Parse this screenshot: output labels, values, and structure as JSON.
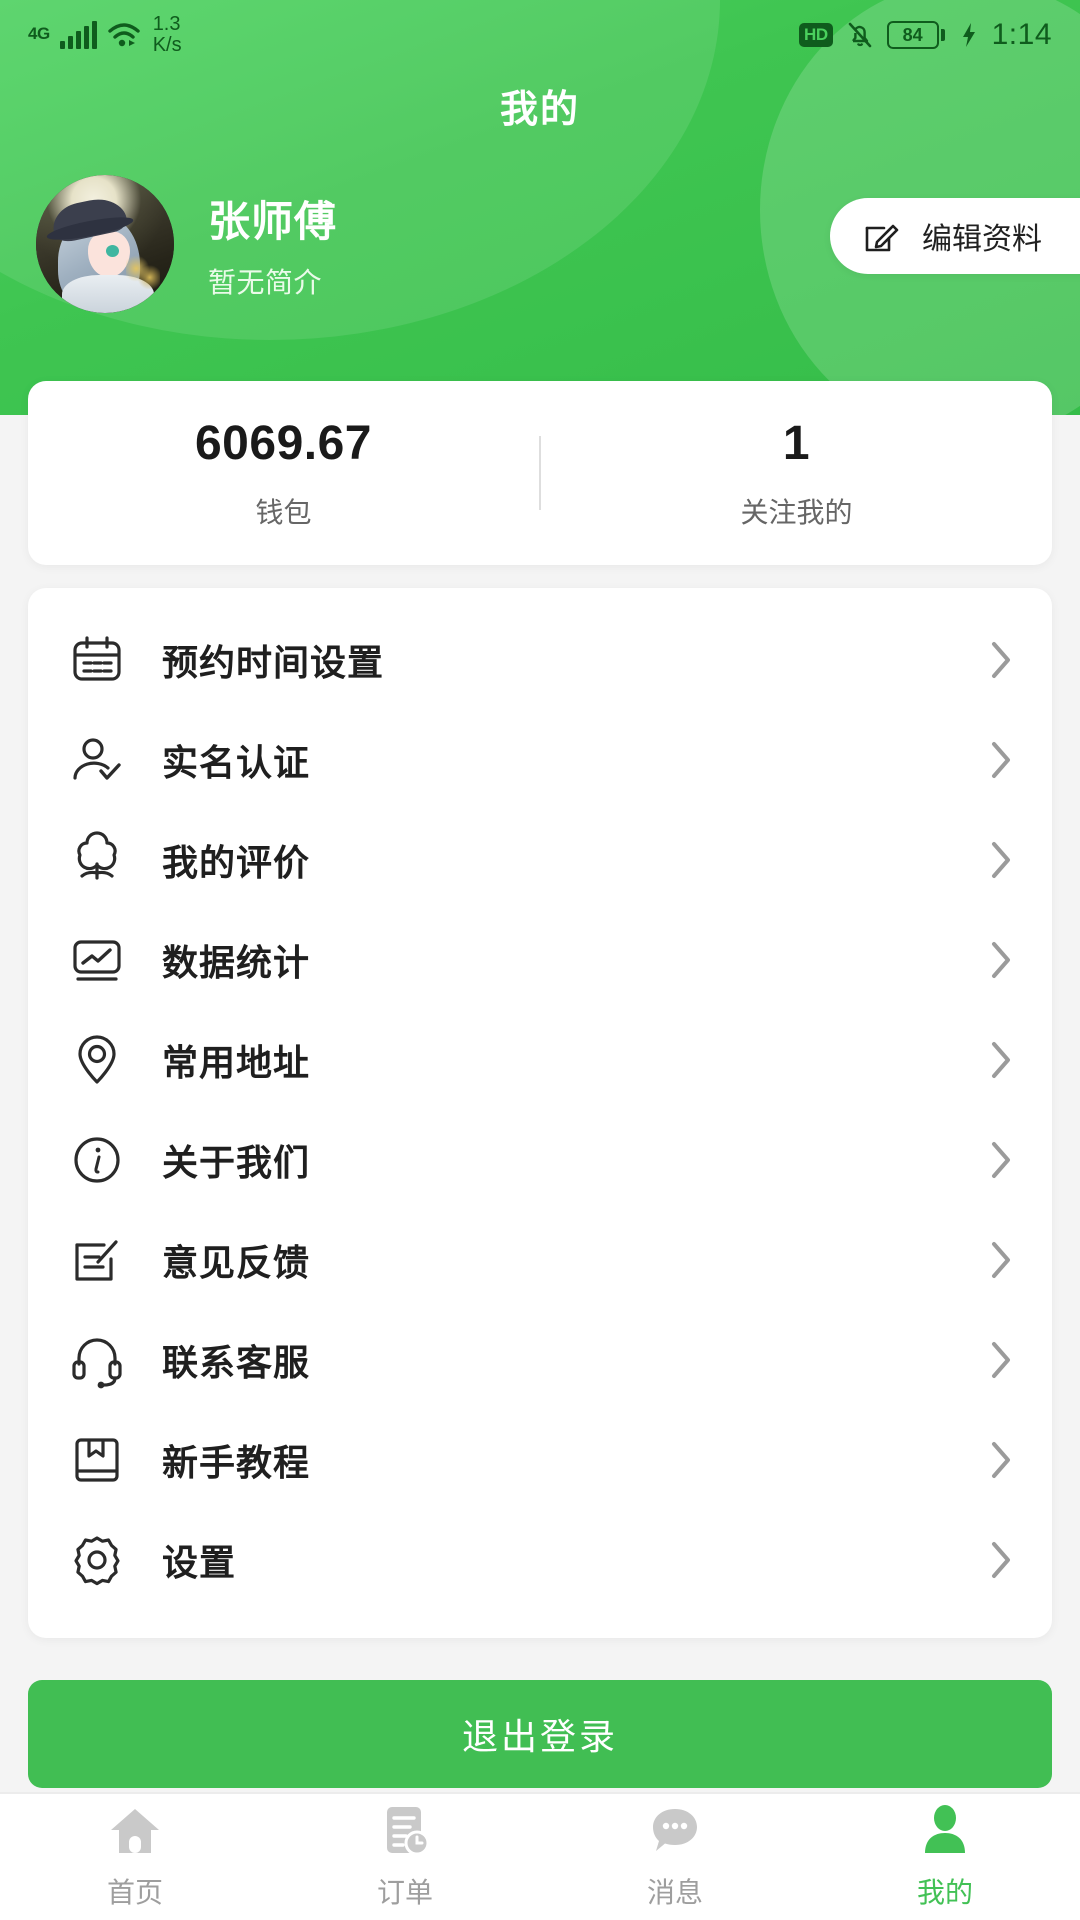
{
  "theme": {
    "brand_green": "#41be53",
    "header_gradient_from": "#4cd15f",
    "header_gradient_to": "#35bd49",
    "page_bg": "#f4f4f4",
    "card_bg": "#ffffff",
    "active_tab_color": "#42c155",
    "inactive_tab_color": "#9e9e9e"
  },
  "status_bar": {
    "network_generation": "4G",
    "net_speed": "1.3",
    "net_speed_unit": "K/s",
    "hd_badge": "HD",
    "battery_percent": "84",
    "time": "1:14",
    "icons": [
      "signal-bars-icon",
      "wifi-icon",
      "hd-icon",
      "bell-muted-icon",
      "battery-icon",
      "charging-bolt-icon"
    ]
  },
  "header": {
    "title": "我的"
  },
  "profile": {
    "name": "张师傅",
    "bio": "暂无简介",
    "avatar_alt": "avatar",
    "edit_button_label": "编辑资料"
  },
  "stats": [
    {
      "value": "6069.67",
      "label": "钱包"
    },
    {
      "value": "1",
      "label": "关注我的"
    }
  ],
  "menu": {
    "items": [
      {
        "label": "预约时间设置",
        "icon": "calendar-icon"
      },
      {
        "label": "实名认证",
        "icon": "user-verified-icon"
      },
      {
        "label": "我的评价",
        "icon": "flower-rating-icon"
      },
      {
        "label": "数据统计",
        "icon": "chart-statistics-icon"
      },
      {
        "label": "常用地址",
        "icon": "location-pin-icon"
      },
      {
        "label": "关于我们",
        "icon": "info-circle-icon"
      },
      {
        "label": "意见反馈",
        "icon": "feedback-edit-icon"
      },
      {
        "label": "联系客服",
        "icon": "headset-icon"
      },
      {
        "label": "新手教程",
        "icon": "book-icon"
      },
      {
        "label": "设置",
        "icon": "gear-icon"
      }
    ]
  },
  "logout": {
    "label": "退出登录"
  },
  "tabbar": {
    "items": [
      {
        "label": "首页",
        "icon": "home-icon",
        "active": false
      },
      {
        "label": "订单",
        "icon": "order-document-clock-icon",
        "active": false
      },
      {
        "label": "消息",
        "icon": "chat-bubble-icon",
        "active": false
      },
      {
        "label": "我的",
        "icon": "person-icon",
        "active": true
      }
    ]
  }
}
